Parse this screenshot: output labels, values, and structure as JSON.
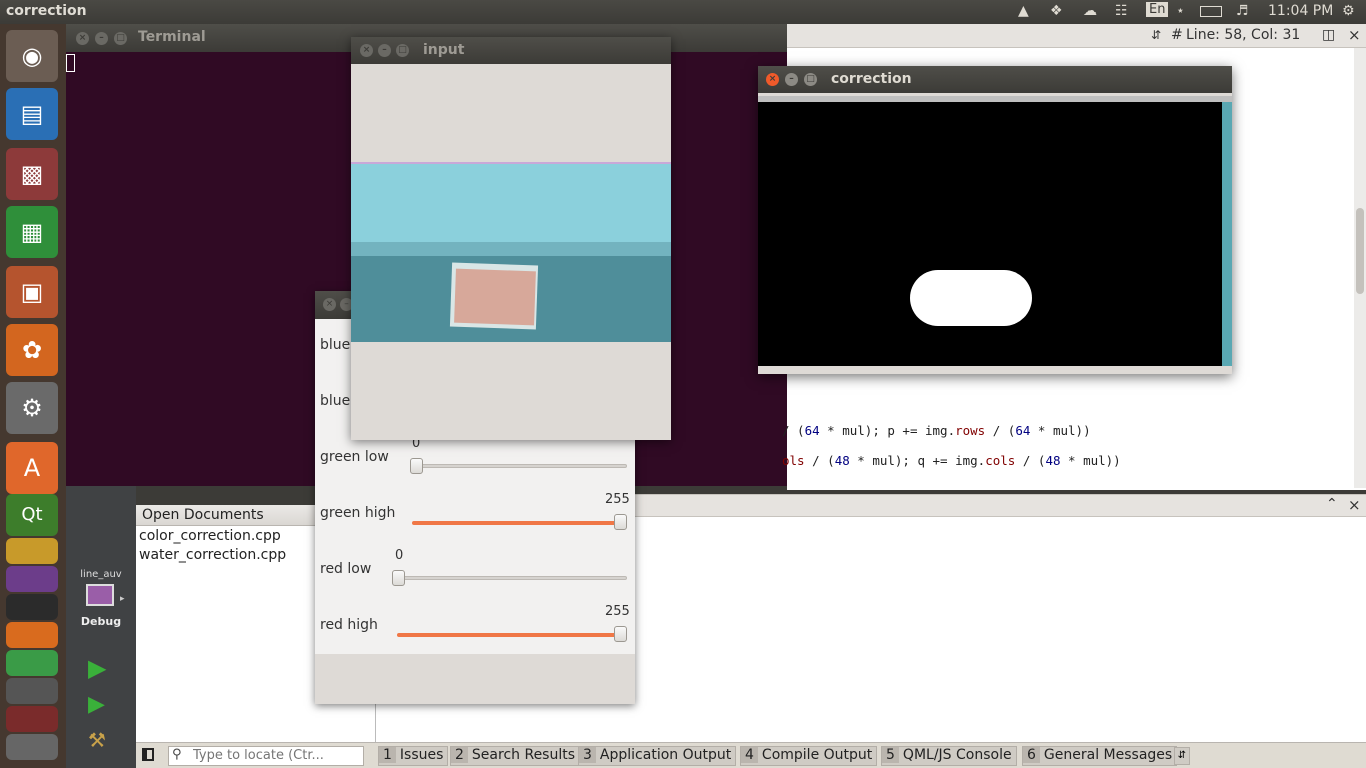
{
  "topbar": {
    "title": "correction",
    "lang": "En",
    "time": "11:04 PM"
  },
  "terminal": {
    "title": "Terminal"
  },
  "editor": {
    "position": "Line: 58, Col: 31",
    "hash": "#",
    "line1_a": "/ (",
    "line1_n1": "64",
    "line1_b": " * mul); p += img.",
    "line1_m": "rows",
    "line1_c": " / (",
    "line1_n2": "64",
    "line1_d": " * mul))",
    "line2_m1": "ols",
    "line2_a": " / (",
    "line2_n1": "48",
    "line2_b": " * mul); q += img.",
    "line2_m2": "cols",
    "line2_c": " / (",
    "line2_n2": "48",
    "line2_d": " * mul))"
  },
  "qt": {
    "project": "line_auv",
    "mode": "Debug"
  },
  "open_documents": {
    "header": "Open Documents",
    "files": [
      "color_correction.cpp",
      "water_correction.cpp"
    ]
  },
  "bottom": {
    "locator_placeholder": "Type to locate (Ctr...",
    "tabs": [
      {
        "num": "1",
        "label": "Issues"
      },
      {
        "num": "2",
        "label": "Search Results"
      },
      {
        "num": "3",
        "label": "Application Output"
      },
      {
        "num": "4",
        "label": "Compile Output"
      },
      {
        "num": "5",
        "label": "QML/JS Console"
      },
      {
        "num": "6",
        "label": "General Messages"
      }
    ]
  },
  "trackbars": {
    "sliders": [
      {
        "label": "blue",
        "value": ""
      },
      {
        "label": "blue",
        "value": ""
      },
      {
        "label": "green low",
        "value": "0",
        "level": 0
      },
      {
        "label": "green high",
        "value": "255",
        "level": 1
      },
      {
        "label": "red low",
        "value": "0",
        "level": 0
      },
      {
        "label": "red high",
        "value": "255",
        "level": 1
      }
    ]
  },
  "input_window": {
    "title": "input"
  },
  "correction_window": {
    "title": "correction"
  },
  "colors": {
    "terminal_bg": "#300a24",
    "accent": "#f07746",
    "launcher_bg": "#45382f"
  }
}
